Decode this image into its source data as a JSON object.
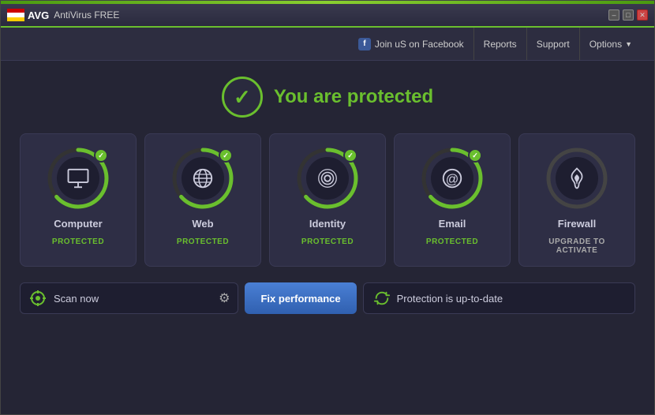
{
  "window": {
    "title": "AVG AntiVirus FREE",
    "subtitle": "AntiVirus FREE",
    "controls": {
      "minimize": "–",
      "restore": "□",
      "close": "✕"
    }
  },
  "nav": {
    "facebook_label": "Join uS on Facebook",
    "facebook_icon": "f",
    "reports_label": "Reports",
    "support_label": "Support",
    "options_label": "Options",
    "options_arrow": "▼"
  },
  "status": {
    "text": "You are protected",
    "check": "✓"
  },
  "cards": [
    {
      "id": "computer",
      "name": "Computer",
      "status": "PROTECTED",
      "active": true
    },
    {
      "id": "web",
      "name": "Web",
      "status": "PROTECTED",
      "active": true
    },
    {
      "id": "identity",
      "name": "Identity",
      "status": "PROTECTED",
      "active": true
    },
    {
      "id": "email",
      "name": "Email",
      "status": "PROTECTED",
      "active": true
    },
    {
      "id": "firewall",
      "name": "Firewall",
      "status": "UPGRADE TO ACTIVATE",
      "active": false
    }
  ],
  "bottom": {
    "scan_label": "Scan now",
    "fix_label": "Fix performance",
    "update_label": "Protection is up-to-date"
  }
}
